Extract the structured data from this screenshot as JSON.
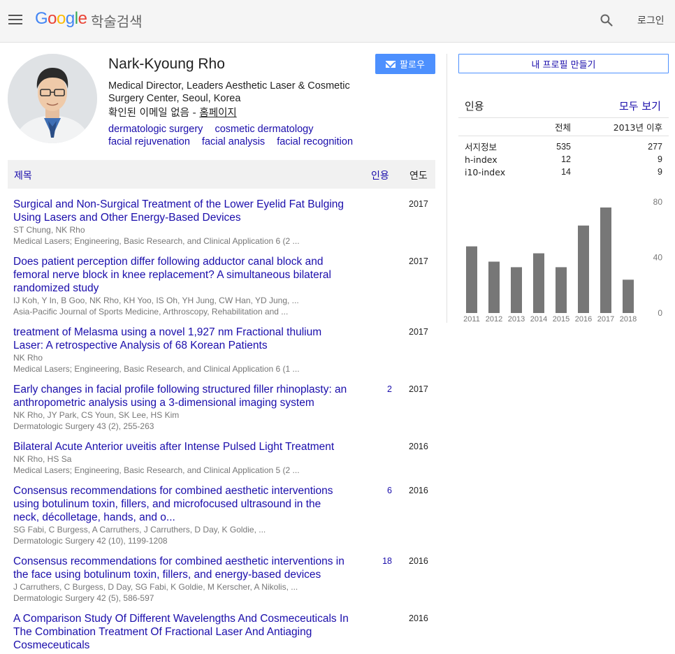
{
  "header": {
    "logo_parts": [
      "G",
      "o",
      "o",
      "g",
      "l",
      "e"
    ],
    "logo_suffix": "학술검색",
    "login": "로그인"
  },
  "profile": {
    "name": "Nark-Kyoung Rho",
    "affiliation": "Medical Director, Leaders Aesthetic Laser & Cosmetic Surgery Center, Seoul, Korea",
    "email_status": "확인된 이메일 없음 - ",
    "homepage": "홈페이지",
    "follow": "팔로우",
    "interests": [
      "dermatologic surgery",
      "cosmetic dermatology",
      "facial rejuvenation",
      "facial analysis",
      "facial recognition"
    ]
  },
  "table": {
    "title_header": "제목",
    "cited_header": "인용",
    "year_header": "연도"
  },
  "articles": [
    {
      "title": "Surgical and Non-Surgical Treatment of the Lower Eyelid Fat Bulging Using Lasers and Other Energy-Based Devices",
      "authors": "ST Chung, NK Rho",
      "venue": "Medical Lasers; Engineering, Basic Research, and Clinical Application 6 (2 ...",
      "cited": "",
      "year": "2017"
    },
    {
      "title": "Does patient perception differ following adductor canal block and femoral nerve block in knee replacement? A simultaneous bilateral randomized study",
      "authors": "IJ Koh, Y In, B Goo, NK Rho, KH Yoo, IS Oh, YH Jung, CW Han, YD Jung, ...",
      "venue": "Asia-Pacific Journal of Sports Medicine, Arthroscopy, Rehabilitation and ...",
      "cited": "",
      "year": "2017"
    },
    {
      "title": "treatment of Melasma using a novel 1,927 nm Fractional thulium Laser: A retrospective Analysis of 68 Korean Patients",
      "authors": "NK Rho",
      "venue": "Medical Lasers; Engineering, Basic Research, and Clinical Application 6 (1 ...",
      "cited": "",
      "year": "2017"
    },
    {
      "title": "Early changes in facial profile following structured filler rhinoplasty: an anthropometric analysis using a 3-dimensional imaging system",
      "authors": "NK Rho, JY Park, CS Youn, SK Lee, HS Kim",
      "venue": "Dermatologic Surgery 43 (2), 255-263",
      "cited": "2",
      "year": "2017"
    },
    {
      "title": "Bilateral Acute Anterior uveitis after Intense Pulsed Light Treatment",
      "authors": "NK Rho, HS Sa",
      "venue": "Medical Lasers; Engineering, Basic Research, and Clinical Application 5 (2 ...",
      "cited": "",
      "year": "2016"
    },
    {
      "title": "Consensus recommendations for combined aesthetic interventions using botulinum toxin, fillers, and microfocused ultrasound in the neck, décolletage, hands, and o...",
      "authors": "SG Fabi, C Burgess, A Carruthers, J Carruthers, D Day, K Goldie, ...",
      "venue": "Dermatologic Surgery 42 (10), 1199-1208",
      "cited": "6",
      "year": "2016"
    },
    {
      "title": "Consensus recommendations for combined aesthetic interventions in the face using botulinum toxin, fillers, and energy-based devices",
      "authors": "J Carruthers, C Burgess, D Day, SG Fabi, K Goldie, M Kerscher, A Nikolis, ...",
      "venue": "Dermatologic Surgery 42 (5), 586-597",
      "cited": "18",
      "year": "2016"
    },
    {
      "title": "A Comparison Study Of Different Wavelengths And Cosmeceuticals In The Combination Treatment Of Fractional Laser And Antiaging Cosmeceuticals",
      "authors": "",
      "venue": "",
      "cited": "",
      "year": "2016"
    }
  ],
  "sidebar": {
    "make_profile": "내 프로필 만들기",
    "cited_by": "인용",
    "view_all": "모두 보기",
    "col_all": "전체",
    "col_since": "2013년 이후",
    "rows": [
      {
        "label": "서지정보",
        "all": "535",
        "since": "277"
      },
      {
        "label": "h-index",
        "all": "12",
        "since": "9"
      },
      {
        "label": "i10-index",
        "all": "14",
        "since": "9"
      }
    ]
  },
  "colors": {
    "link": "#1a0dab",
    "button": "#4d90fe",
    "bar": "#777777"
  },
  "chart_data": {
    "type": "bar",
    "categories": [
      "2011",
      "2012",
      "2013",
      "2014",
      "2015",
      "2016",
      "2017",
      "2018"
    ],
    "values": [
      48,
      37,
      33,
      43,
      33,
      63,
      76,
      24
    ],
    "ylim": [
      0,
      80
    ],
    "yticks": [
      "80",
      "40",
      "0"
    ],
    "ytick_positions": "right",
    "grid": false
  }
}
